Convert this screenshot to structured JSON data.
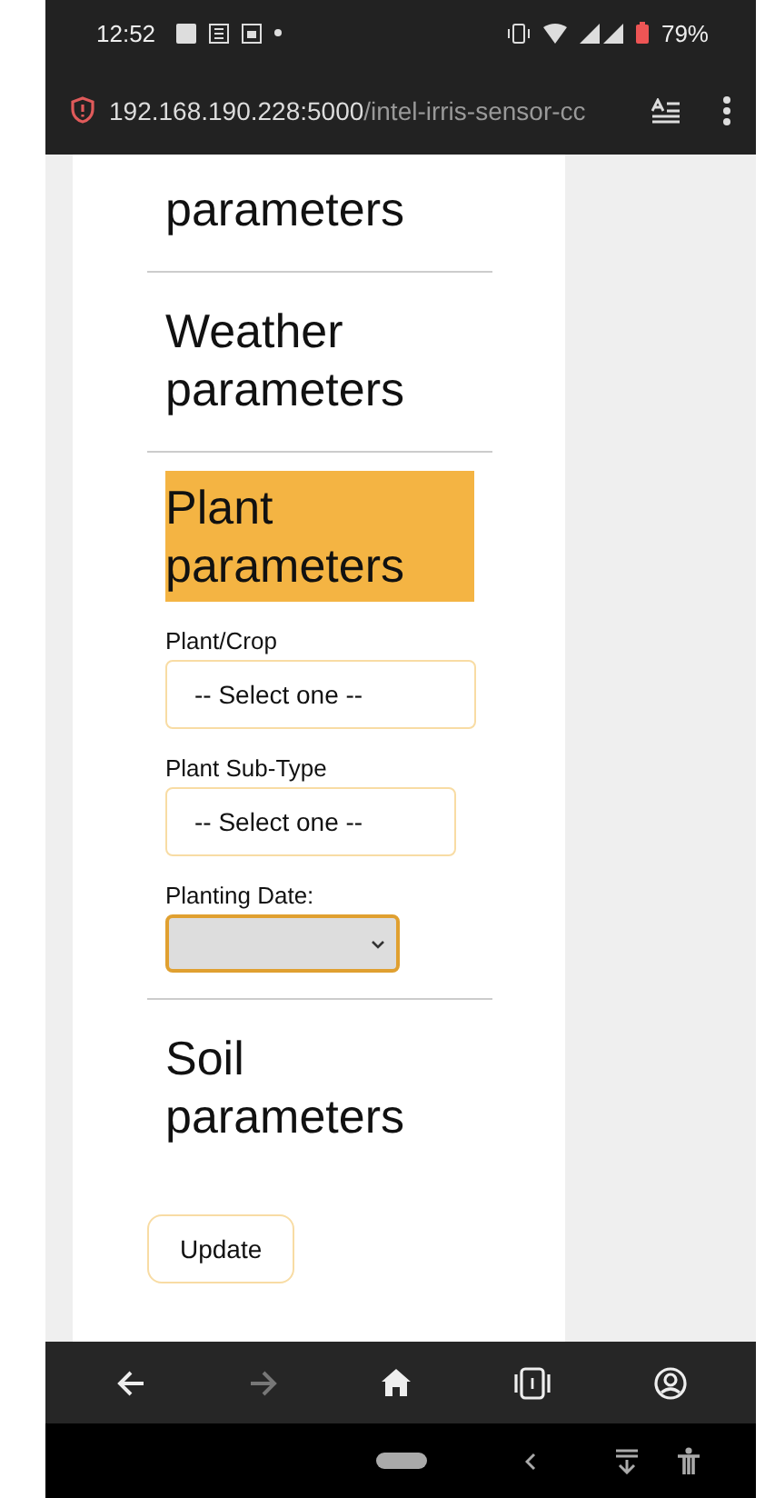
{
  "status_bar": {
    "time": "12:52",
    "battery": "79%"
  },
  "address_bar": {
    "url_host": "192.168.190.228:5000",
    "url_path": "/intel-irris-sensor-cc"
  },
  "sections": [
    {
      "title": "parameters",
      "expanded": false
    },
    {
      "title": "Weather parameters",
      "expanded": false
    },
    {
      "title": "Plant parameters",
      "expanded": true,
      "fields": [
        {
          "label": "Plant/Crop",
          "kind": "select",
          "value": "-- Select one --",
          "focused": false
        },
        {
          "label": "Plant Sub-Type",
          "kind": "select",
          "value": "-- Select one --",
          "focused": false
        },
        {
          "label": "Planting Date:",
          "kind": "date",
          "focused": true
        }
      ]
    },
    {
      "title": "Soil parameters",
      "expanded": false
    }
  ],
  "update_button": "Update"
}
